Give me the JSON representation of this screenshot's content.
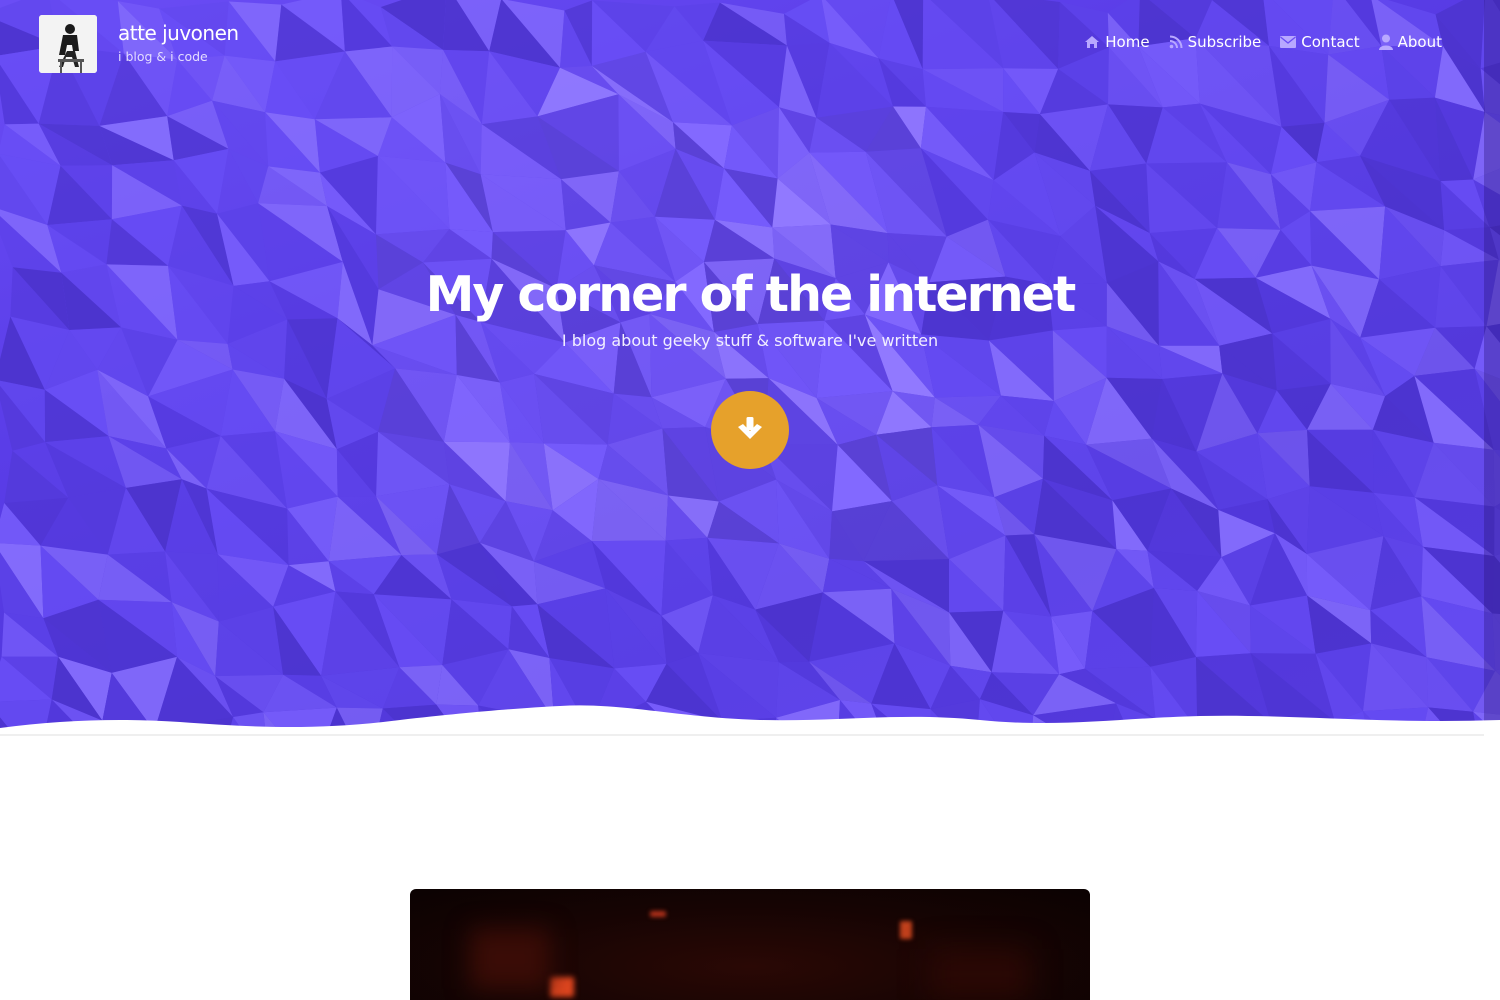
{
  "site": {
    "name": "atte juvonen",
    "tagline": "i blog & i code"
  },
  "nav": {
    "items": [
      {
        "label": "Home",
        "icon": "home-icon"
      },
      {
        "label": "Subscribe",
        "icon": "rss-icon"
      },
      {
        "label": "Contact",
        "icon": "envelope-icon"
      },
      {
        "label": "About",
        "icon": "user-icon"
      }
    ]
  },
  "hero": {
    "title": "My corner of the internet",
    "subtitle": "I blog about geeky stuff & software I've written",
    "scroll_icon": "arrow-down-icon"
  },
  "colors": {
    "hero_bg": "#5a3de8",
    "accent": "#e6a12b",
    "text": "#ffffff"
  }
}
